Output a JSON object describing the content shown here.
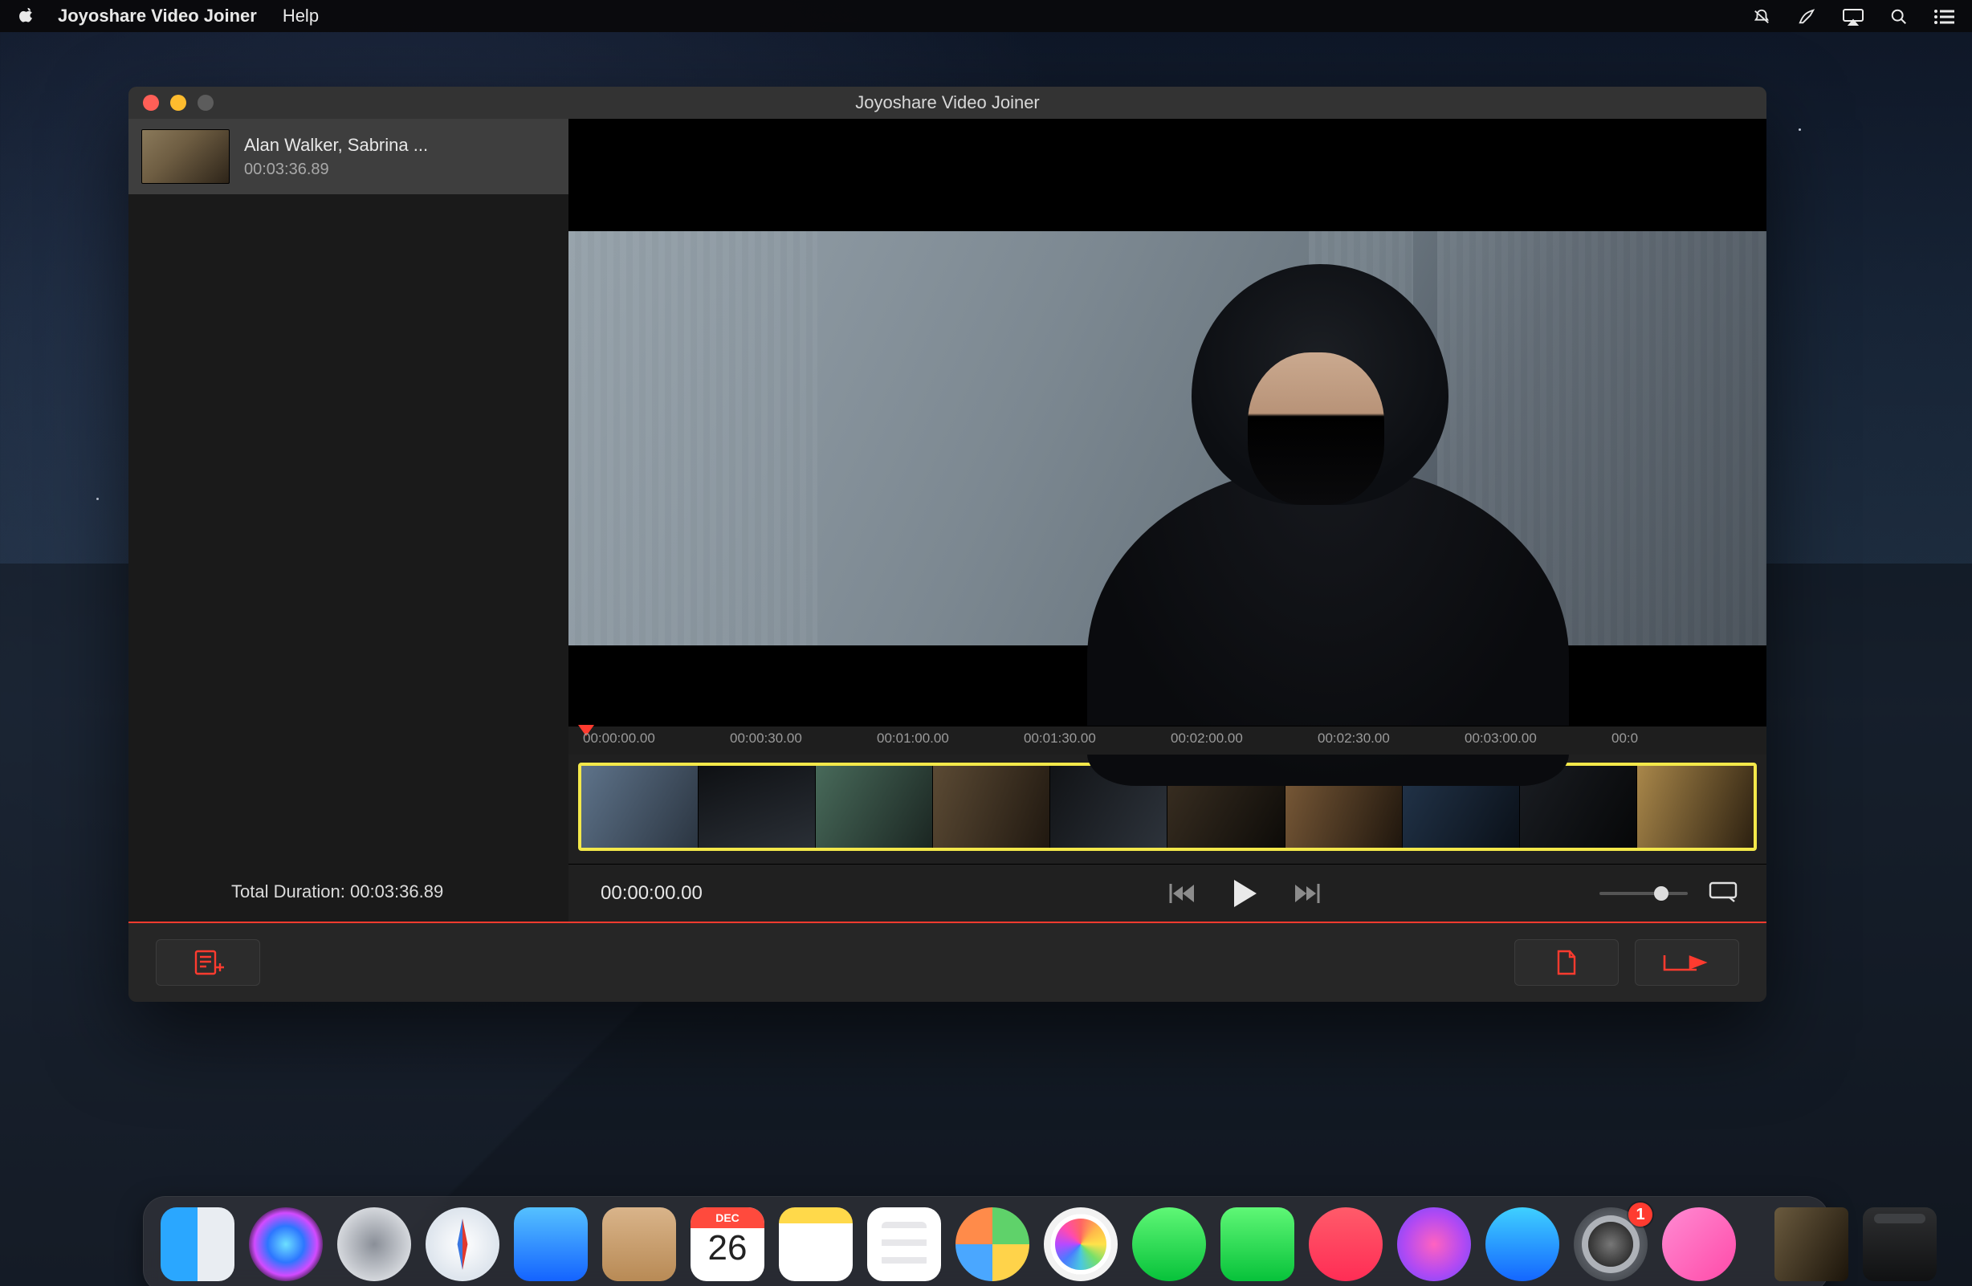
{
  "menubar": {
    "app_name": "Joyoshare Video Joiner",
    "menus": [
      "Help"
    ]
  },
  "window": {
    "title": "Joyoshare Video Joiner"
  },
  "sidebar": {
    "clips": [
      {
        "name": "Alan Walker, Sabrina ...",
        "duration": "00:03:36.89"
      }
    ],
    "total_label": "Total Duration:",
    "total_value": "00:03:36.89"
  },
  "timeline": {
    "ticks": [
      "00:00:00.00",
      "00:00:30.00",
      "00:01:00.00",
      "00:01:30.00",
      "00:02:00.00",
      "00:02:30.00",
      "00:03:00.00",
      "00:0"
    ]
  },
  "controls": {
    "current_time": "00:00:00.00"
  },
  "dock": {
    "calendar": {
      "month": "DEC",
      "day": "26"
    },
    "badge_settings": "1"
  }
}
